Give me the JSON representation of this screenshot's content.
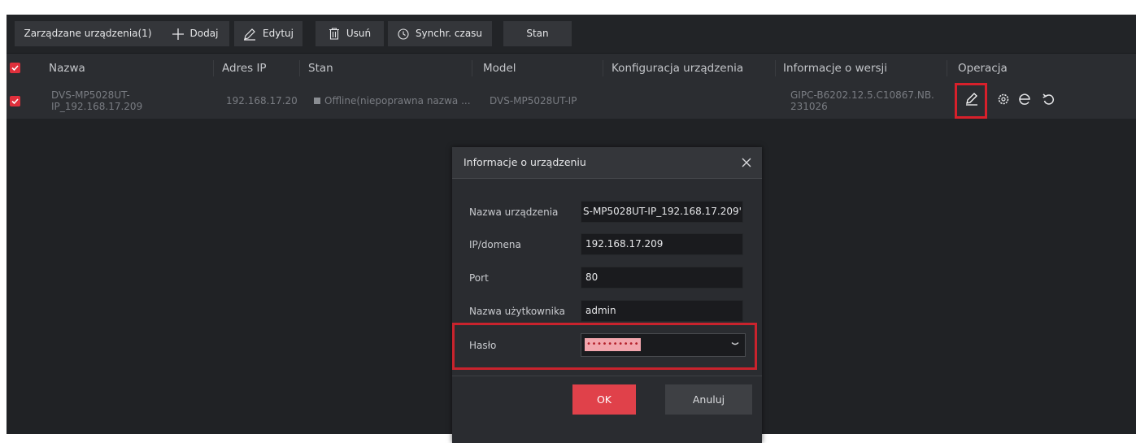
{
  "toolbar": {
    "managed_devices": "Zarządzane urządzenia(1)",
    "add": "Dodaj",
    "edit": "Edytuj",
    "delete": "Usuń",
    "sync_time": "Synchr. czasu",
    "status": "Stan"
  },
  "table": {
    "headers": {
      "name": "Nazwa",
      "ip": "Adres IP",
      "status": "Stan",
      "model": "Model",
      "config": "Konfiguracja urządzenia",
      "version": "Informacje o wersji",
      "operation": "Operacja"
    },
    "rows": [
      {
        "checked": true,
        "name_line1": "DVS-MP5028UT-",
        "name_line2": "IP_192.168.17.209",
        "ip": "192.168.17.20",
        "status": "Offline(niepoprawna nazwa ...",
        "model": "DVS-MP5028UT-IP",
        "version_line1": "GIPC-B6202.12.5.C10867.NB.",
        "version_line2": "231026"
      }
    ],
    "operation_icons": [
      "edit-icon",
      "settings-icon",
      "browser-icon",
      "restart-icon"
    ]
  },
  "dialog": {
    "title": "Informacje o urządzeniu",
    "fields": {
      "device_name_label": "Nazwa urządzenia",
      "device_name_value": "'S-MP5028UT-IP_192.168.17.209",
      "ip_label": "IP/domena",
      "ip_value": "192.168.17.209",
      "port_label": "Port",
      "port_value": "80",
      "user_label": "Nazwa użytkownika",
      "user_value": "admin",
      "password_label": "Hasło",
      "password_value": "••••••••••"
    },
    "ok": "OK",
    "cancel": "Anuluj"
  },
  "colors": {
    "accent": "#e0414a",
    "highlight": "#d8202b",
    "background": "#202225"
  }
}
